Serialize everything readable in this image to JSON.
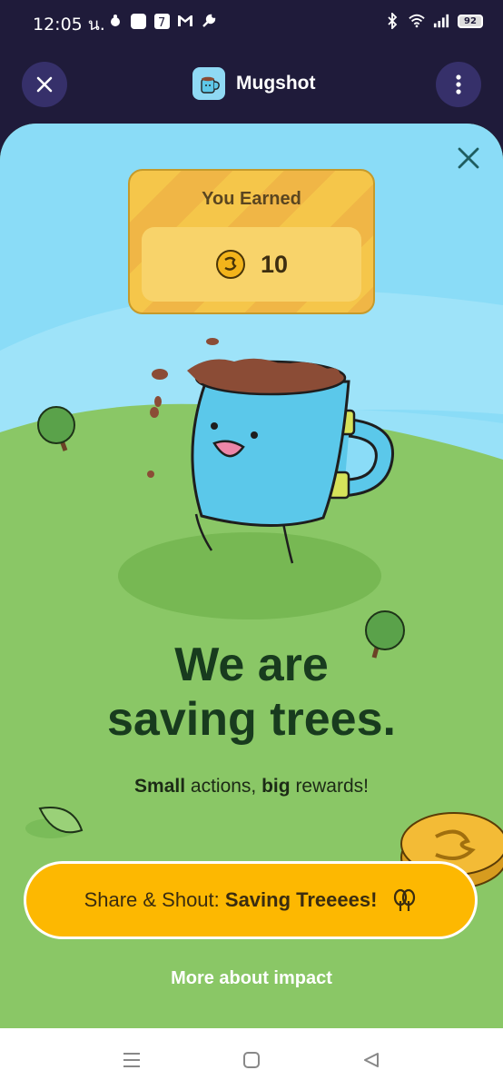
{
  "status_bar": {
    "time": "12:05 น.",
    "battery": "92"
  },
  "header": {
    "app_name": "Mugshot"
  },
  "reward": {
    "label": "You Earned",
    "amount": "10"
  },
  "headline": {
    "line1": "We are",
    "line2": "saving trees."
  },
  "subline": {
    "small": "Small",
    "middle": " actions, ",
    "big": "big",
    "end": " rewards!"
  },
  "cta": {
    "prefix": "Share & Shout: ",
    "bold": "Saving Treeees!"
  },
  "more_link": "More about impact",
  "colors": {
    "header_bg": "#1f1b3a",
    "sky": "#8adcf7",
    "grass": "#8ac766",
    "cta": "#fdb801",
    "headline": "#183b1e"
  }
}
